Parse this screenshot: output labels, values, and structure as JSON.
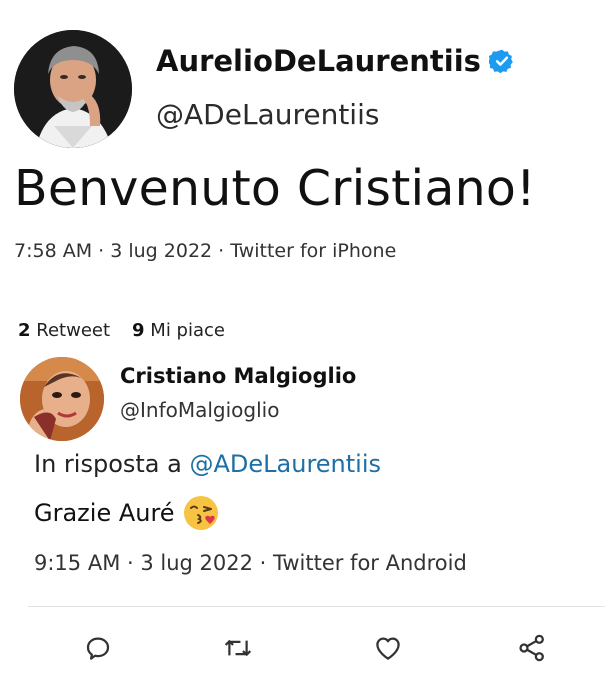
{
  "tweet": {
    "author_name": "AurelioDeLaurentiis",
    "author_handle": "@ADeLaurentiis",
    "text": "Benvenuto Cristiano!",
    "meta": "7:58 AM · 3 lug 2022 · Twitter for iPhone",
    "retweets_count": "2",
    "retweets_label": "Retweet",
    "likes_count": "9",
    "likes_label": "Mi piace"
  },
  "reply": {
    "author_name": "Cristiano Malgioglio",
    "author_handle": "@InfoMalgioglio",
    "in_reply_prefix": "In risposta a",
    "in_reply_mention": "@ADeLaurentiis",
    "text": "Grazie Auré",
    "meta": "9:15 AM · 3 lug 2022 · Twitter for Android"
  },
  "icons": [
    "verified-badge-icon",
    "kiss-emoji-icon",
    "reply-icon",
    "retweet-icon",
    "like-icon",
    "share-icon"
  ],
  "colors": {
    "verified": "#1d9bf0",
    "mention": "#1d6fa5",
    "action_icon": "#333333",
    "emoji": "#f6c343",
    "emoji_lips": "#e0334c"
  }
}
